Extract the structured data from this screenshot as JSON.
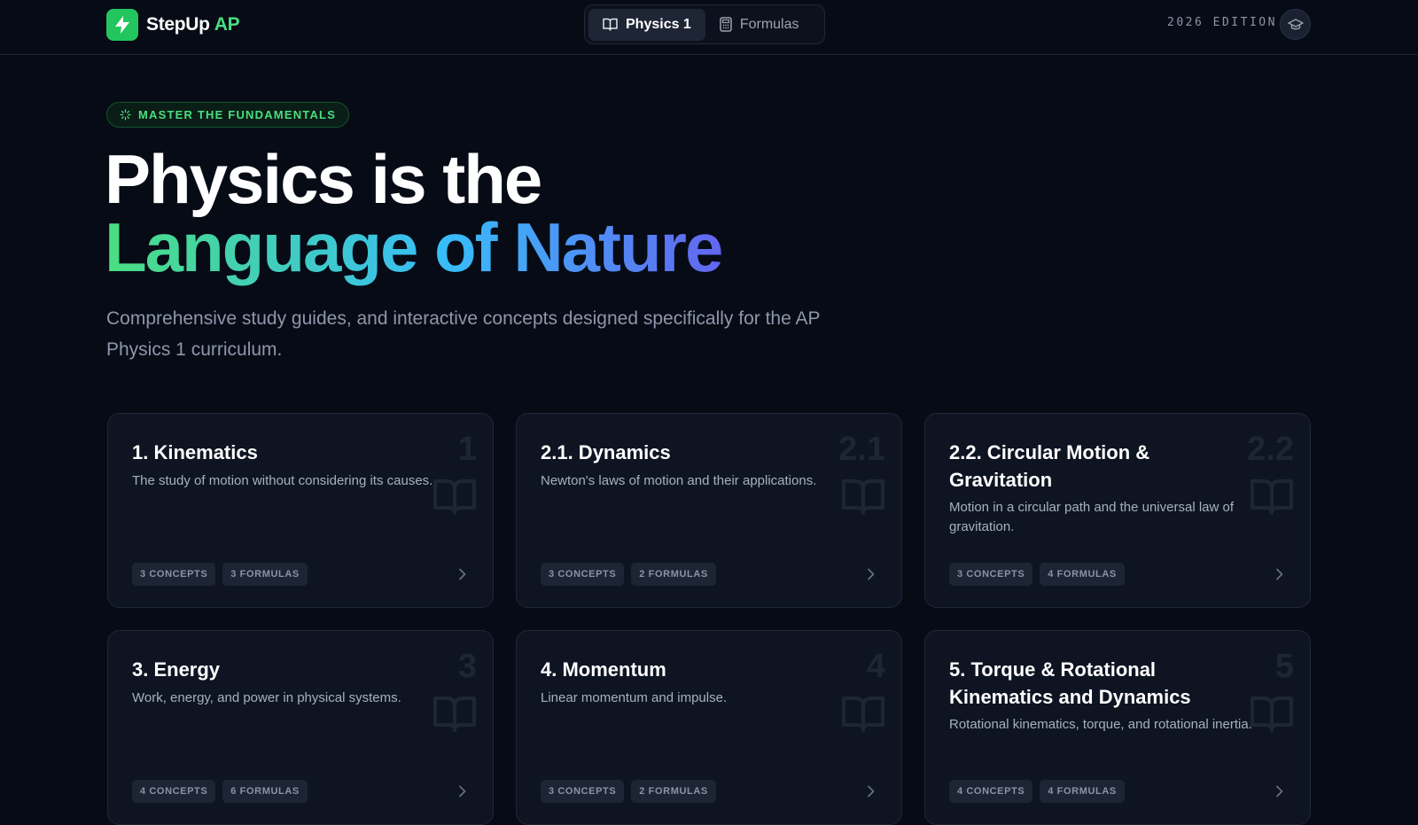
{
  "header": {
    "brand_name": "StepUp",
    "brand_accent": "AP",
    "tabs": [
      {
        "label": "Physics 1",
        "icon": "book-icon",
        "active": true
      },
      {
        "label": "Formulas",
        "icon": "calculator-icon",
        "active": false
      }
    ],
    "edition": "2026 EDITION",
    "avatar_icon": "graduation-cap-icon"
  },
  "hero": {
    "badge": "MASTER THE FUNDAMENTALS",
    "title_line1": "Physics is the",
    "title_line2": "Language of Nature",
    "subtitle": "Comprehensive study guides, and interactive concepts designed specifically for the AP Physics 1 curriculum."
  },
  "colors": {
    "background": "#070b16",
    "accent_green": "#4ade80",
    "gradient_blue": "#38bdf8",
    "gradient_indigo": "#6366f1",
    "card_background": "#0e1422"
  },
  "units": [
    {
      "number": "1",
      "title": "1. Kinematics",
      "description": "The study of motion without considering its causes.",
      "concepts": "3 CONCEPTS",
      "formulas": "3 FORMULAS"
    },
    {
      "number": "2.1",
      "title": "2.1. Dynamics",
      "description": "Newton's laws of motion and their applications.",
      "concepts": "3 CONCEPTS",
      "formulas": "2 FORMULAS"
    },
    {
      "number": "2.2",
      "title": "2.2. Circular Motion & Gravitation",
      "description": "Motion in a circular path and the universal law of gravitation.",
      "concepts": "3 CONCEPTS",
      "formulas": "4 FORMULAS"
    },
    {
      "number": "3",
      "title": "3. Energy",
      "description": "Work, energy, and power in physical systems.",
      "concepts": "4 CONCEPTS",
      "formulas": "6 FORMULAS"
    },
    {
      "number": "4",
      "title": "4. Momentum",
      "description": "Linear momentum and impulse.",
      "concepts": "3 CONCEPTS",
      "formulas": "2 FORMULAS"
    },
    {
      "number": "5",
      "title": "5. Torque & Rotational Kinematics and Dynamics",
      "description": "Rotational kinematics, torque, and rotational inertia.",
      "concepts": "4 CONCEPTS",
      "formulas": "4 FORMULAS"
    }
  ]
}
